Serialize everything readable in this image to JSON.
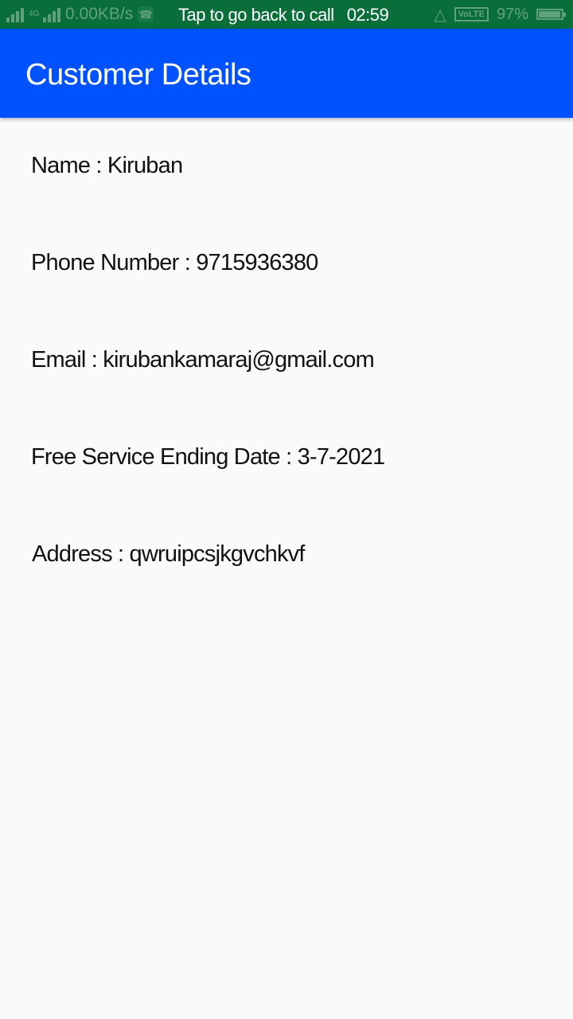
{
  "status_bar": {
    "network_speed": "0.00KB/s",
    "network_type": "4G",
    "call_banner": "Tap to go back to call",
    "time": "02:59",
    "volte": "VoLTE",
    "battery": "97%",
    "battery_level": 0.97,
    "icons": [
      "signal-icon",
      "signal-icon",
      "call-icon",
      "mute-icon",
      "volte-icon",
      "battery-icon"
    ]
  },
  "app_bar": {
    "title": "Customer Details",
    "color": "#0052ff"
  },
  "details": [
    {
      "label": "Name : Kiruban"
    },
    {
      "label": "Phone Number : 9715936380"
    },
    {
      "label": "Email : kirubankamaraj@gmail.com"
    },
    {
      "label": "Free Service Ending Date : 3-7-2021"
    },
    {
      "label": "Address : qwruipcsjkgvchkvf"
    }
  ]
}
